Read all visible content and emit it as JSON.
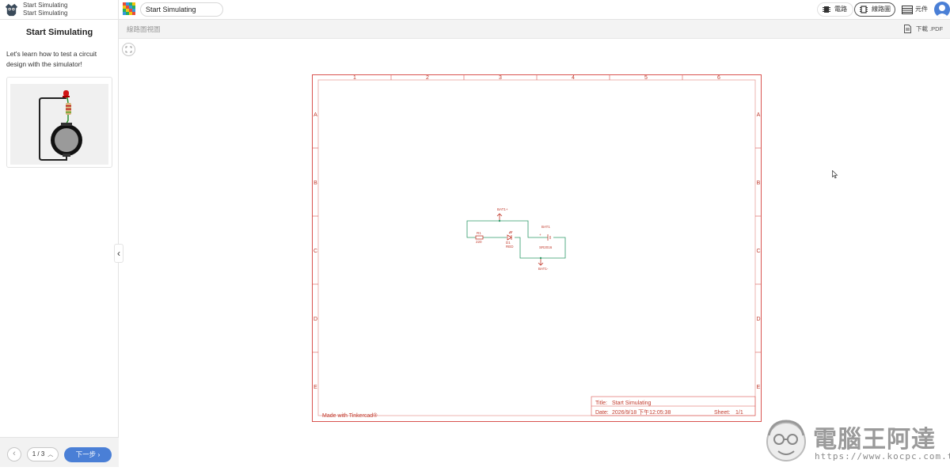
{
  "sidebar": {
    "lesson_line1": "Start Simulating",
    "lesson_line2": "Start Simulating",
    "title": "Start Simulating",
    "description": "Let's learn how to test a circuit design with the simulator!",
    "footer": {
      "prev_icon": "chevron-left-icon",
      "step": "1 / 3",
      "next_label": "下一步"
    }
  },
  "topbar": {
    "design_name": "Start Simulating",
    "views": [
      {
        "label": "電路",
        "icon": "chip-icon"
      },
      {
        "label": "線路圖",
        "icon": "schematic-icon",
        "active": true
      },
      {
        "label": "元件",
        "icon": "table-icon"
      }
    ]
  },
  "subbar": {
    "view_title": "線路圖視圖",
    "download_label": "下載 .PDF"
  },
  "schematic": {
    "columns": [
      "1",
      "2",
      "3",
      "4",
      "5",
      "6"
    ],
    "rows": [
      "A",
      "B",
      "C",
      "D",
      "E"
    ],
    "made_with": "Made with Tinkercad®",
    "title_label": "Title:",
    "title_value": "Start Simulating",
    "date_label": "Date:",
    "date_value": "2026/9/18 下午12:05:38",
    "sheet_label": "Sheet:",
    "sheet_value": "1/1",
    "parts": {
      "bat_plus": "BAT1+",
      "bat_minus": "BAT1-",
      "r1": "R1",
      "r1_value": "220",
      "d1": "D1",
      "d1_value": "RED",
      "bat1": "BAT1",
      "bat1_value": "SR2016",
      "plus_sign": "+"
    },
    "accent": "#c0392b",
    "wire": "#2e9a6a"
  },
  "watermark": {
    "name": "電腦王阿達",
    "url": "https://www.kocpc.com.tw/"
  },
  "colors": {
    "primary": "#4a7fd6",
    "sheet_border": "#d9534f"
  }
}
